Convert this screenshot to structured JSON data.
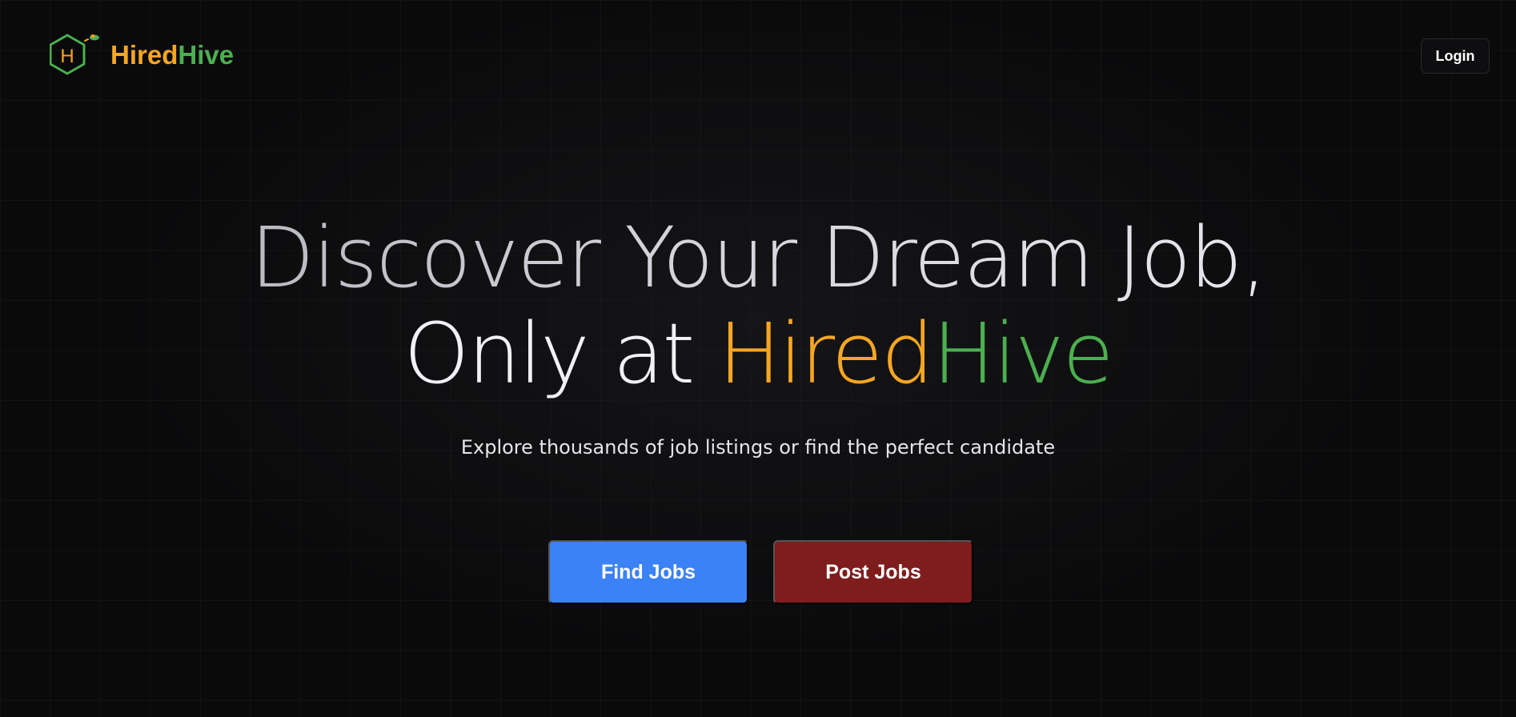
{
  "brand": {
    "name_part1": "Hired",
    "name_part2": "Hive",
    "logo_icon": "hexagon-bee-icon",
    "logo_letter": "H",
    "colors": {
      "orange": "#f5a623",
      "green": "#4caf50"
    }
  },
  "header": {
    "login_label": "Login"
  },
  "hero": {
    "headline_line1": "Discover Your Dream Job,",
    "headline_line2_prefix": "Only at ",
    "headline_highlight1": "Hired",
    "headline_highlight2": "Hive",
    "subtitle": "Explore thousands of job listings or find the perfect candidate"
  },
  "actions": {
    "find_jobs_label": "Find Jobs",
    "post_jobs_label": "Post Jobs",
    "find_jobs_color": "#3b82f6",
    "post_jobs_color": "#7f1d1d"
  }
}
